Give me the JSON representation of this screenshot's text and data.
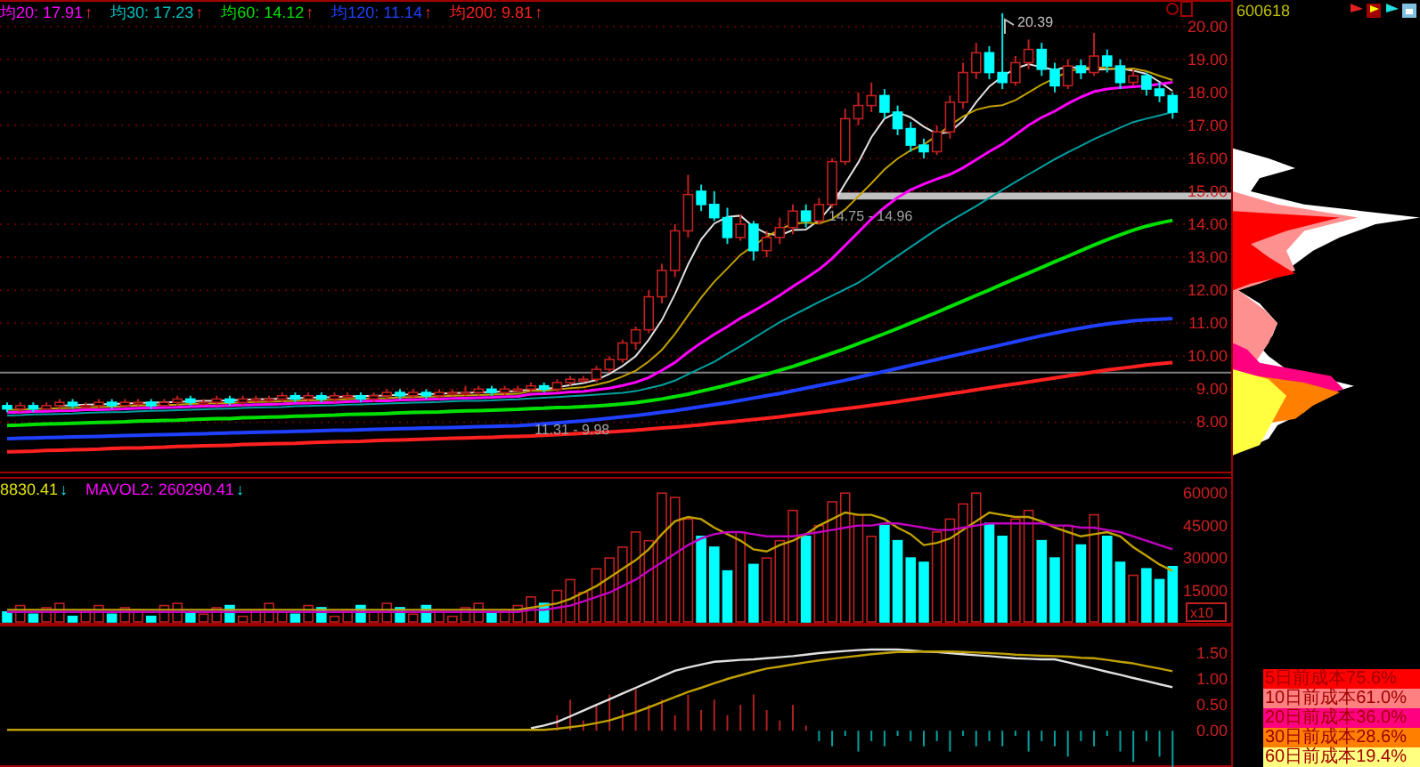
{
  "ma_legend": [
    {
      "label": "均20: 17.91",
      "arrow": "↑",
      "color": "#ff00ff"
    },
    {
      "label": "均30: 17.23",
      "arrow": "↑",
      "color": "#00c0c0"
    },
    {
      "label": "均60: 14.12",
      "arrow": "↑",
      "color": "#00e000"
    },
    {
      "label": "均120: 11.14",
      "arrow": "↑",
      "color": "#2040ff"
    },
    {
      "label": "均200: 9.81",
      "arrow": "↑",
      "color": "#ff2020"
    }
  ],
  "chart_data": {
    "type": "candlestick",
    "ylim": [
      6.5,
      20.8
    ],
    "grid": true,
    "yticks": [
      {
        "value": 20,
        "label": "20.00"
      },
      {
        "value": 19,
        "label": "19.00"
      },
      {
        "value": 18,
        "label": "18.00"
      },
      {
        "value": 17,
        "label": "17.00"
      },
      {
        "value": 16,
        "label": "16.00"
      },
      {
        "value": 15,
        "label": "15.00"
      },
      {
        "value": 14,
        "label": "14.00"
      },
      {
        "value": 13,
        "label": "13.00"
      },
      {
        "value": 12,
        "label": "12.00"
      },
      {
        "value": 11,
        "label": "11.00"
      },
      {
        "value": 10,
        "label": "10.00"
      },
      {
        "value": 9,
        "label": "9.00"
      },
      {
        "value": 8,
        "label": "8.00"
      }
    ],
    "ohlc": [
      [
        8.5,
        8.6,
        8.3,
        8.4
      ],
      [
        8.4,
        8.6,
        8.3,
        8.5
      ],
      [
        8.5,
        8.6,
        8.3,
        8.4
      ],
      [
        8.4,
        8.6,
        8.4,
        8.5
      ],
      [
        8.5,
        8.7,
        8.4,
        8.6
      ],
      [
        8.6,
        8.7,
        8.4,
        8.5
      ],
      [
        8.5,
        8.6,
        8.4,
        8.5
      ],
      [
        8.5,
        8.7,
        8.4,
        8.6
      ],
      [
        8.6,
        8.7,
        8.4,
        8.5
      ],
      [
        8.5,
        8.7,
        8.5,
        8.6
      ],
      [
        8.6,
        8.7,
        8.5,
        8.6
      ],
      [
        8.6,
        8.7,
        8.4,
        8.5
      ],
      [
        8.5,
        8.7,
        8.5,
        8.6
      ],
      [
        8.6,
        8.8,
        8.5,
        8.7
      ],
      [
        8.7,
        8.8,
        8.5,
        8.6
      ],
      [
        8.6,
        8.7,
        8.5,
        8.6
      ],
      [
        8.6,
        8.8,
        8.5,
        8.7
      ],
      [
        8.7,
        8.8,
        8.5,
        8.6
      ],
      [
        8.6,
        8.8,
        8.5,
        8.7
      ],
      [
        8.7,
        8.8,
        8.6,
        8.7
      ],
      [
        8.7,
        8.8,
        8.6,
        8.7
      ],
      [
        8.7,
        8.9,
        8.6,
        8.8
      ],
      [
        8.8,
        8.9,
        8.6,
        8.7
      ],
      [
        8.7,
        8.9,
        8.6,
        8.8
      ],
      [
        8.8,
        8.9,
        8.6,
        8.7
      ],
      [
        8.7,
        8.9,
        8.6,
        8.8
      ],
      [
        8.8,
        8.9,
        8.7,
        8.8
      ],
      [
        8.8,
        8.9,
        8.6,
        8.7
      ],
      [
        8.7,
        8.9,
        8.6,
        8.8
      ],
      [
        8.8,
        9.0,
        8.7,
        8.9
      ],
      [
        8.9,
        9.0,
        8.7,
        8.8
      ],
      [
        8.8,
        9.0,
        8.7,
        8.9
      ],
      [
        8.9,
        9.0,
        8.7,
        8.8
      ],
      [
        8.8,
        9.0,
        8.7,
        8.9
      ],
      [
        8.9,
        9.0,
        8.8,
        8.9
      ],
      [
        8.9,
        9.1,
        8.8,
        8.9
      ],
      [
        8.9,
        9.1,
        8.8,
        9.0
      ],
      [
        9.0,
        9.1,
        8.8,
        8.9
      ],
      [
        8.9,
        9.1,
        8.8,
        9.0
      ],
      [
        9.0,
        9.1,
        8.9,
        9.0
      ],
      [
        9.0,
        9.2,
        8.9,
        9.1
      ],
      [
        9.1,
        9.2,
        8.9,
        9.0
      ],
      [
        9.0,
        9.3,
        8.9,
        9.2
      ],
      [
        9.2,
        9.4,
        9.1,
        9.3
      ],
      [
        9.3,
        9.4,
        9.2,
        9.3
      ],
      [
        9.3,
        9.7,
        9.2,
        9.6
      ],
      [
        9.6,
        10.0,
        9.5,
        9.9
      ],
      [
        9.9,
        10.5,
        9.8,
        10.4
      ],
      [
        10.4,
        10.9,
        10.2,
        10.8
      ],
      [
        10.8,
        12.0,
        10.7,
        11.8
      ],
      [
        11.8,
        12.8,
        11.6,
        12.6
      ],
      [
        12.6,
        14.0,
        12.4,
        13.8
      ],
      [
        13.8,
        15.5,
        13.6,
        14.9
      ],
      [
        15.0,
        15.2,
        14.4,
        14.6
      ],
      [
        14.6,
        15.0,
        14.1,
        14.2
      ],
      [
        14.2,
        14.5,
        13.4,
        13.6
      ],
      [
        13.6,
        14.3,
        13.5,
        14.0
      ],
      [
        14.0,
        14.1,
        12.9,
        13.2
      ],
      [
        13.2,
        13.8,
        13.0,
        13.6
      ],
      [
        13.6,
        14.2,
        13.4,
        13.9
      ],
      [
        13.9,
        14.6,
        13.7,
        14.4
      ],
      [
        14.4,
        14.6,
        13.9,
        14.1
      ],
      [
        14.1,
        14.8,
        14.0,
        14.6
      ],
      [
        14.6,
        16.0,
        14.5,
        15.9
      ],
      [
        15.9,
        17.5,
        15.8,
        17.2
      ],
      [
        17.2,
        18.0,
        17.0,
        17.6
      ],
      [
        17.6,
        18.3,
        17.4,
        17.9
      ],
      [
        17.9,
        18.1,
        17.2,
        17.4
      ],
      [
        17.4,
        17.6,
        16.7,
        16.9
      ],
      [
        16.9,
        17.1,
        16.2,
        16.4
      ],
      [
        16.4,
        16.6,
        16.0,
        16.2
      ],
      [
        16.2,
        17.0,
        16.1,
        16.8
      ],
      [
        16.8,
        17.9,
        16.6,
        17.7
      ],
      [
        17.7,
        18.9,
        17.5,
        18.6
      ],
      [
        18.6,
        19.5,
        18.4,
        19.2
      ],
      [
        19.2,
        19.4,
        18.4,
        18.6
      ],
      [
        18.6,
        20.4,
        18.1,
        18.3
      ],
      [
        18.3,
        19.1,
        18.2,
        18.9
      ],
      [
        18.9,
        19.6,
        18.7,
        19.3
      ],
      [
        19.3,
        19.5,
        18.5,
        18.7
      ],
      [
        18.7,
        18.9,
        18.0,
        18.2
      ],
      [
        18.2,
        19.0,
        18.1,
        18.8
      ],
      [
        18.8,
        19.0,
        18.4,
        18.6
      ],
      [
        18.6,
        19.8,
        18.5,
        19.1
      ],
      [
        19.1,
        19.3,
        18.6,
        18.8
      ],
      [
        18.8,
        19.0,
        18.1,
        18.3
      ],
      [
        18.3,
        18.7,
        18.2,
        18.5
      ],
      [
        18.5,
        18.6,
        17.9,
        18.1
      ],
      [
        18.1,
        18.3,
        17.7,
        17.9
      ],
      [
        17.9,
        18.0,
        17.2,
        17.4
      ]
    ],
    "bands": [
      {
        "axis": "y",
        "from": 14.75,
        "to": 14.96
      }
    ],
    "ref_lines": [
      {
        "axis": "y",
        "value": 9.5
      }
    ],
    "series": [
      {
        "type": "line",
        "color": "#e0e0e0",
        "values": [
          null,
          null,
          null,
          null,
          8.5,
          8.51,
          8.53,
          8.54,
          8.55,
          8.56,
          8.58,
          8.59,
          8.6,
          8.61,
          8.63,
          8.64,
          8.65,
          8.66,
          8.68,
          8.69,
          8.7,
          8.71,
          8.73,
          8.74,
          8.75,
          8.76,
          8.78,
          8.79,
          8.8,
          8.81,
          8.83,
          8.84,
          8.85,
          8.86,
          8.88,
          8.89,
          8.9,
          8.91,
          8.93,
          8.94,
          9.0,
          9.0,
          9.06,
          9.12,
          9.18,
          9.28,
          9.46,
          9.7,
          10.0,
          10.5,
          11.1,
          11.88,
          12.78,
          13.54,
          14.02,
          14.22,
          14.26,
          13.92,
          13.72,
          13.66,
          13.82,
          13.84,
          14.12,
          14.58,
          15.24,
          15.88,
          16.64,
          17.2,
          17.4,
          17.24,
          16.96,
          16.74,
          16.8,
          17.14,
          17.7,
          18.18,
          18.48,
          18.72,
          18.86,
          18.76,
          18.68,
          18.78,
          18.72,
          18.68,
          18.7,
          18.72,
          18.66,
          18.56,
          18.32,
          18.04
        ]
      },
      {
        "type": "line",
        "color": "#c0a000",
        "values": [
          8.37,
          8.38,
          8.4,
          8.41,
          8.42,
          8.43,
          8.45,
          8.46,
          8.47,
          8.48,
          8.5,
          8.51,
          8.52,
          8.53,
          8.55,
          8.56,
          8.57,
          8.58,
          8.6,
          8.61,
          8.62,
          8.63,
          8.65,
          8.66,
          8.67,
          8.68,
          8.7,
          8.71,
          8.72,
          8.73,
          8.75,
          8.76,
          8.77,
          8.78,
          8.8,
          8.81,
          8.82,
          8.83,
          8.85,
          8.86,
          8.95,
          8.95,
          8.99,
          9.03,
          9.06,
          9.14,
          9.23,
          9.38,
          9.56,
          9.84,
          10.19,
          10.67,
          11.24,
          11.77,
          12.26,
          12.66,
          13.07,
          13.35,
          13.63,
          13.84,
          14.02,
          14.05,
          14.02,
          14.15,
          14.45,
          14.85,
          15.24,
          15.66,
          15.99,
          16.24,
          16.42,
          16.69,
          17.0,
          17.27,
          17.47,
          17.57,
          17.61,
          17.76,
          18.0,
          18.23,
          18.43,
          18.63,
          18.72,
          18.77,
          18.73,
          18.7,
          18.72,
          18.64,
          18.5,
          18.37
        ]
      },
      {
        "type": "line",
        "color": "#ff00ff",
        "values": [
          8.29,
          8.3,
          8.32,
          8.33,
          8.34,
          8.35,
          8.37,
          8.38,
          8.39,
          8.4,
          8.42,
          8.43,
          8.44,
          8.45,
          8.47,
          8.48,
          8.49,
          8.5,
          8.52,
          8.53,
          8.54,
          8.55,
          8.57,
          8.58,
          8.59,
          8.6,
          8.62,
          8.63,
          8.64,
          8.65,
          8.67,
          8.68,
          8.69,
          8.7,
          8.72,
          8.73,
          8.74,
          8.75,
          8.77,
          8.78,
          8.85,
          8.86,
          8.88,
          8.91,
          8.93,
          8.98,
          9.03,
          9.11,
          9.21,
          9.35,
          9.57,
          9.81,
          10.12,
          10.4,
          10.66,
          10.9,
          11.15,
          11.37,
          11.6,
          11.84,
          12.11,
          12.36,
          12.63,
          12.96,
          13.36,
          13.76,
          14.16,
          14.51,
          14.81,
          15.04,
          15.22,
          15.37,
          15.51,
          15.71,
          15.96,
          16.21,
          16.43,
          16.71,
          17.0,
          17.24,
          17.43,
          17.66,
          17.86,
          18.02,
          18.1,
          18.14,
          18.17,
          18.2,
          18.25,
          18.3
        ]
      },
      {
        "type": "line",
        "color": "#00a0a0",
        "values": [
          8.2,
          8.21,
          8.23,
          8.24,
          8.25,
          8.26,
          8.28,
          8.29,
          8.3,
          8.31,
          8.33,
          8.34,
          8.35,
          8.36,
          8.38,
          8.39,
          8.4,
          8.41,
          8.43,
          8.44,
          8.45,
          8.46,
          8.48,
          8.49,
          8.5,
          8.51,
          8.53,
          8.54,
          8.55,
          8.56,
          8.58,
          8.59,
          8.6,
          8.61,
          8.63,
          8.64,
          8.65,
          8.66,
          8.68,
          8.69,
          8.72,
          8.74,
          8.76,
          8.79,
          8.81,
          8.83,
          8.86,
          8.89,
          8.94,
          9.03,
          9.12,
          9.26,
          9.45,
          9.64,
          9.83,
          10.07,
          10.3,
          10.54,
          10.79,
          11.03,
          11.24,
          11.44,
          11.64,
          11.83,
          12.03,
          12.23,
          12.49,
          12.77,
          13.04,
          13.31,
          13.58,
          13.85,
          14.09,
          14.32,
          14.55,
          14.8,
          15.04,
          15.28,
          15.51,
          15.74,
          15.97,
          16.18,
          16.38,
          16.58,
          16.76,
          16.93,
          17.1,
          17.2,
          17.3,
          17.4
        ]
      },
      {
        "type": "line",
        "color": "#00e000",
        "values": [
          7.9,
          7.91,
          7.93,
          7.94,
          7.95,
          7.96,
          7.98,
          7.99,
          8.0,
          8.01,
          8.03,
          8.04,
          8.05,
          8.06,
          8.08,
          8.09,
          8.1,
          8.11,
          8.13,
          8.14,
          8.15,
          8.16,
          8.18,
          8.19,
          8.2,
          8.21,
          8.23,
          8.24,
          8.25,
          8.26,
          8.28,
          8.29,
          8.3,
          8.31,
          8.33,
          8.34,
          8.35,
          8.36,
          8.38,
          8.39,
          8.41,
          8.42,
          8.44,
          8.45,
          8.47,
          8.49,
          8.52,
          8.55,
          8.59,
          8.64,
          8.7,
          8.77,
          8.85,
          8.94,
          9.03,
          9.13,
          9.23,
          9.34,
          9.45,
          9.57,
          9.69,
          9.82,
          9.95,
          10.09,
          10.23,
          10.38,
          10.53,
          10.68,
          10.84,
          11.0,
          11.16,
          11.33,
          11.5,
          11.67,
          11.84,
          12.01,
          12.18,
          12.35,
          12.52,
          12.69,
          12.86,
          13.03,
          13.2,
          13.37,
          13.53,
          13.68,
          13.82,
          13.94,
          14.04,
          14.12
        ]
      },
      {
        "type": "line",
        "color": "#2040ff",
        "values": [
          7.5,
          7.51,
          7.52,
          7.53,
          7.54,
          7.55,
          7.56,
          7.57,
          7.58,
          7.59,
          7.6,
          7.61,
          7.62,
          7.63,
          7.64,
          7.65,
          7.66,
          7.67,
          7.68,
          7.69,
          7.7,
          7.71,
          7.72,
          7.73,
          7.74,
          7.75,
          7.76,
          7.77,
          7.78,
          7.79,
          7.8,
          7.81,
          7.82,
          7.83,
          7.84,
          7.85,
          7.86,
          7.87,
          7.88,
          7.89,
          7.92,
          7.95,
          7.98,
          8.01,
          8.04,
          8.08,
          8.12,
          8.16,
          8.2,
          8.25,
          8.3,
          8.35,
          8.41,
          8.47,
          8.53,
          8.59,
          8.66,
          8.73,
          8.8,
          8.87,
          8.95,
          9.03,
          9.11,
          9.19,
          9.27,
          9.36,
          9.45,
          9.54,
          9.63,
          9.72,
          9.81,
          9.9,
          9.99,
          10.08,
          10.17,
          10.26,
          10.35,
          10.44,
          10.53,
          10.62,
          10.7,
          10.78,
          10.85,
          10.92,
          10.98,
          11.03,
          11.07,
          11.1,
          11.12,
          11.14
        ]
      },
      {
        "type": "line",
        "color": "#ff2020",
        "values": [
          7.1,
          7.11,
          7.12,
          7.14,
          7.15,
          7.16,
          7.17,
          7.18,
          7.2,
          7.21,
          7.22,
          7.23,
          7.24,
          7.26,
          7.27,
          7.28,
          7.29,
          7.3,
          7.32,
          7.33,
          7.34,
          7.35,
          7.36,
          7.38,
          7.39,
          7.4,
          7.41,
          7.42,
          7.44,
          7.45,
          7.46,
          7.47,
          7.48,
          7.5,
          7.51,
          7.52,
          7.53,
          7.54,
          7.56,
          7.57,
          7.58,
          7.6,
          7.62,
          7.64,
          7.66,
          7.68,
          7.7,
          7.73,
          7.76,
          7.79,
          7.82,
          7.85,
          7.88,
          7.92,
          7.96,
          8.0,
          8.04,
          8.08,
          8.12,
          8.16,
          8.21,
          8.26,
          8.31,
          8.36,
          8.41,
          8.46,
          8.51,
          8.56,
          8.62,
          8.68,
          8.74,
          8.8,
          8.86,
          8.92,
          8.98,
          9.04,
          9.1,
          9.16,
          9.22,
          9.28,
          9.34,
          9.4,
          9.46,
          9.52,
          9.58,
          9.63,
          9.68,
          9.73,
          9.77,
          9.81
        ]
      }
    ]
  },
  "stock_code": "600618",
  "annotations": [
    {
      "kind": "peak",
      "text": "20.39"
    },
    {
      "kind": "range",
      "text": "14.75 - 14.96"
    },
    {
      "kind": "range",
      "text": "11.31 - 9.98"
    }
  ],
  "volume_legend": [
    {
      "label": "8830.41",
      "arrow": "↓",
      "color": "#e0e000"
    },
    {
      "label": "MAVOL2: 260290.41",
      "arrow": "↓",
      "color": "#ff00ff"
    }
  ],
  "volume": {
    "chart_data": {
      "type": "bar",
      "ylim": [
        0,
        67500
      ],
      "yticks": [
        {
          "value": 60000,
          "label": "60000"
        },
        {
          "value": 45000,
          "label": "45000"
        },
        {
          "value": 30000,
          "label": "30000"
        },
        {
          "value": 15000,
          "label": "15000"
        }
      ],
      "series": [
        {
          "type": "bar",
          "color": "#c02020",
          "values": [
            null,
            8000,
            null,
            7000,
            9000,
            null,
            6000,
            8000,
            null,
            7000,
            6000,
            null,
            8000,
            9000,
            null,
            4000,
            7000,
            null,
            3000,
            6000,
            9000,
            5000,
            null,
            8000,
            null,
            3000,
            6000,
            null,
            5000,
            9000,
            null,
            4000,
            null,
            6000,
            3000,
            7000,
            9000,
            null,
            6000,
            8000,
            12000,
            null,
            15000,
            20000,
            14000,
            25000,
            30000,
            35000,
            42000,
            38000,
            60000,
            58000,
            48000,
            null,
            null,
            null,
            42000,
            null,
            30000,
            38000,
            52000,
            null,
            45000,
            56000,
            60000,
            50000,
            40000,
            null,
            null,
            null,
            null,
            42000,
            48000,
            55000,
            60000,
            null,
            null,
            48000,
            52000,
            null,
            null,
            45000,
            null,
            50000,
            null,
            null,
            22000,
            null,
            null,
            null
          ]
        },
        {
          "type": "bar",
          "color": "#00ffff",
          "values": [
            5000,
            null,
            4000,
            null,
            null,
            3000,
            null,
            null,
            4000,
            null,
            null,
            3000,
            null,
            null,
            5000,
            null,
            null,
            8000,
            null,
            null,
            null,
            null,
            4000,
            null,
            7000,
            null,
            null,
            8000,
            null,
            null,
            7000,
            null,
            8000,
            null,
            null,
            null,
            null,
            5000,
            null,
            null,
            null,
            9000,
            null,
            null,
            null,
            null,
            null,
            null,
            null,
            null,
            null,
            null,
            null,
            40000,
            35000,
            24000,
            null,
            27000,
            null,
            null,
            null,
            40000,
            null,
            null,
            null,
            null,
            null,
            45000,
            38000,
            30000,
            28000,
            null,
            null,
            null,
            null,
            46000,
            40000,
            null,
            null,
            38000,
            30000,
            null,
            36000,
            null,
            40000,
            28000,
            null,
            25000,
            20000,
            26000
          ]
        },
        {
          "type": "line",
          "color": "#c0a000",
          "values": [
            6000,
            6000,
            6000,
            6000,
            6000,
            6000,
            6000,
            6000,
            6000,
            6000,
            6000,
            6000,
            6000,
            6000,
            6000,
            6000,
            6000,
            6000,
            6000,
            6000,
            6000,
            6000,
            6000,
            6000,
            6000,
            6000,
            6000,
            6000,
            6000,
            6000,
            6000,
            6000,
            6000,
            6000,
            6000,
            6000,
            6000,
            6000,
            6000,
            6000,
            7000,
            8000,
            9000,
            11000,
            14000,
            17000,
            21000,
            25000,
            29000,
            34000,
            41000,
            47000,
            49000,
            48000,
            44000,
            41000,
            38000,
            34000,
            33000,
            36000,
            38000,
            41000,
            45000,
            48000,
            51000,
            50000,
            50000,
            48000,
            44000,
            41000,
            36000,
            37000,
            39000,
            43000,
            47000,
            51000,
            50000,
            49000,
            49000,
            47000,
            44000,
            42000,
            40000,
            41000,
            42000,
            40000,
            35000,
            31000,
            27000,
            24000
          ]
        },
        {
          "type": "line",
          "color": "#c000c0",
          "values": [
            5000,
            5000,
            5000,
            5000,
            5000,
            5000,
            5000,
            5000,
            5000,
            5000,
            5000,
            5000,
            5000,
            5000,
            5000,
            5000,
            5000,
            5000,
            5000,
            5000,
            5000,
            5000,
            5000,
            5000,
            5000,
            5000,
            5000,
            5000,
            5000,
            5000,
            5000,
            5000,
            5000,
            5000,
            5000,
            5000,
            5000,
            5000,
            5000,
            5000,
            6000,
            6000,
            7000,
            8000,
            10000,
            12000,
            14000,
            17000,
            20000,
            24000,
            28000,
            32000,
            36000,
            39000,
            41000,
            42000,
            42000,
            41000,
            40000,
            40000,
            40000,
            41000,
            42000,
            43000,
            44000,
            45000,
            45000,
            46000,
            46000,
            45000,
            44000,
            43000,
            43000,
            44000,
            45000,
            46000,
            46000,
            46000,
            46000,
            46000,
            45000,
            45000,
            44000,
            44000,
            43000,
            42000,
            40000,
            38000,
            36000,
            34000
          ]
        }
      ]
    },
    "unit": "x10"
  },
  "indicator": {
    "chart_data": {
      "type": "line",
      "ylim": [
        -0.7,
        2.05
      ],
      "yticks": [
        {
          "value": 1.5,
          "label": "1.50"
        },
        {
          "value": 1,
          "label": "1.00"
        },
        {
          "value": 0.5,
          "label": "0.50"
        },
        {
          "value": 0,
          "label": "0.00"
        }
      ],
      "series": [
        {
          "type": "bar",
          "color": "#b02020",
          "values": [
            null,
            null,
            null,
            null,
            null,
            null,
            null,
            null,
            null,
            null,
            null,
            null,
            null,
            null,
            null,
            null,
            null,
            null,
            null,
            null,
            null,
            null,
            null,
            null,
            null,
            null,
            null,
            null,
            null,
            null,
            null,
            null,
            null,
            null,
            null,
            null,
            null,
            null,
            null,
            null,
            null,
            null,
            0.3,
            0.6,
            0.2,
            0.5,
            0.7,
            0.4,
            0.8,
            0.5,
            0.6,
            0.3,
            0.7,
            0.4,
            0.6,
            0.3,
            0.5,
            0.7,
            0.4,
            0.2,
            0.5,
            0.1,
            null,
            null,
            null,
            null,
            null,
            null,
            null,
            null,
            null,
            null,
            null,
            null,
            null,
            null,
            null,
            null,
            null,
            null,
            null,
            null,
            null,
            null,
            null,
            null,
            null,
            null,
            null,
            null
          ]
        },
        {
          "type": "bar",
          "color": "#00a0a0",
          "values": [
            null,
            null,
            null,
            null,
            null,
            null,
            null,
            null,
            null,
            null,
            null,
            null,
            null,
            null,
            null,
            null,
            null,
            null,
            null,
            null,
            null,
            null,
            null,
            null,
            null,
            null,
            null,
            null,
            null,
            null,
            null,
            null,
            null,
            null,
            null,
            null,
            null,
            null,
            null,
            null,
            null,
            null,
            null,
            null,
            null,
            null,
            null,
            null,
            null,
            null,
            null,
            null,
            null,
            null,
            null,
            null,
            null,
            null,
            null,
            null,
            null,
            null,
            -0.2,
            -0.3,
            -0.1,
            -0.4,
            -0.2,
            -0.3,
            -0.1,
            -0.2,
            -0.3,
            -0.2,
            -0.4,
            -0.1,
            -0.3,
            -0.2,
            -0.3,
            -0.1,
            -0.4,
            -0.2,
            -0.3,
            -0.5,
            -0.2,
            -0.3,
            -0.1,
            -0.4,
            -0.6,
            -0.2,
            -0.5,
            -0.7
          ]
        },
        {
          "type": "line",
          "color": "#e0e0e0",
          "values": [
            null,
            null,
            null,
            null,
            null,
            null,
            null,
            null,
            null,
            null,
            null,
            null,
            null,
            null,
            null,
            null,
            null,
            null,
            null,
            null,
            null,
            null,
            null,
            null,
            null,
            null,
            null,
            null,
            null,
            null,
            null,
            null,
            null,
            null,
            null,
            null,
            null,
            null,
            null,
            null,
            0.05,
            0.1,
            0.17,
            0.28,
            0.39,
            0.5,
            0.61,
            0.72,
            0.83,
            0.94,
            1.05,
            1.16,
            1.22,
            1.28,
            1.33,
            1.35,
            1.37,
            1.38,
            1.4,
            1.42,
            1.44,
            1.47,
            1.5,
            1.52,
            1.54,
            1.56,
            1.57,
            1.57,
            1.57,
            1.55,
            1.53,
            1.52,
            1.5,
            1.48,
            1.46,
            1.44,
            1.42,
            1.4,
            1.39,
            1.38,
            1.38,
            1.32,
            1.26,
            1.2,
            1.14,
            1.08,
            1.02,
            0.96,
            0.9,
            0.84
          ]
        },
        {
          "type": "line",
          "color": "#c0a000",
          "values": [
            0.02,
            0.02,
            0.02,
            0.02,
            0.02,
            0.02,
            0.02,
            0.02,
            0.02,
            0.02,
            0.02,
            0.02,
            0.02,
            0.02,
            0.02,
            0.02,
            0.02,
            0.02,
            0.02,
            0.02,
            0.02,
            0.02,
            0.02,
            0.02,
            0.02,
            0.02,
            0.02,
            0.02,
            0.02,
            0.02,
            0.02,
            0.02,
            0.02,
            0.02,
            0.02,
            0.02,
            0.02,
            0.02,
            0.02,
            0.02,
            0.02,
            0.02,
            0.04,
            0.07,
            0.1,
            0.15,
            0.2,
            0.28,
            0.36,
            0.45,
            0.55,
            0.65,
            0.75,
            0.83,
            0.92,
            1.0,
            1.07,
            1.14,
            1.2,
            1.24,
            1.28,
            1.32,
            1.36,
            1.39,
            1.42,
            1.45,
            1.48,
            1.5,
            1.52,
            1.52,
            1.53,
            1.53,
            1.53,
            1.52,
            1.51,
            1.5,
            1.49,
            1.47,
            1.46,
            1.45,
            1.44,
            1.43,
            1.41,
            1.4,
            1.37,
            1.33,
            1.3,
            1.25,
            1.2,
            1.15
          ]
        }
      ]
    }
  },
  "cost_legend": [
    {
      "label": "5日前成本75.6%",
      "color": "#ff0000"
    },
    {
      "label": "10日前成本61.0%",
      "color": "#ff8080"
    },
    {
      "label": "20日前成本36.0%",
      "color": "#ff0080"
    },
    {
      "label": "30日前成本28.6%",
      "color": "#ff8000"
    },
    {
      "label": "60日前成本19.4%",
      "color": "#ffff80"
    }
  ]
}
